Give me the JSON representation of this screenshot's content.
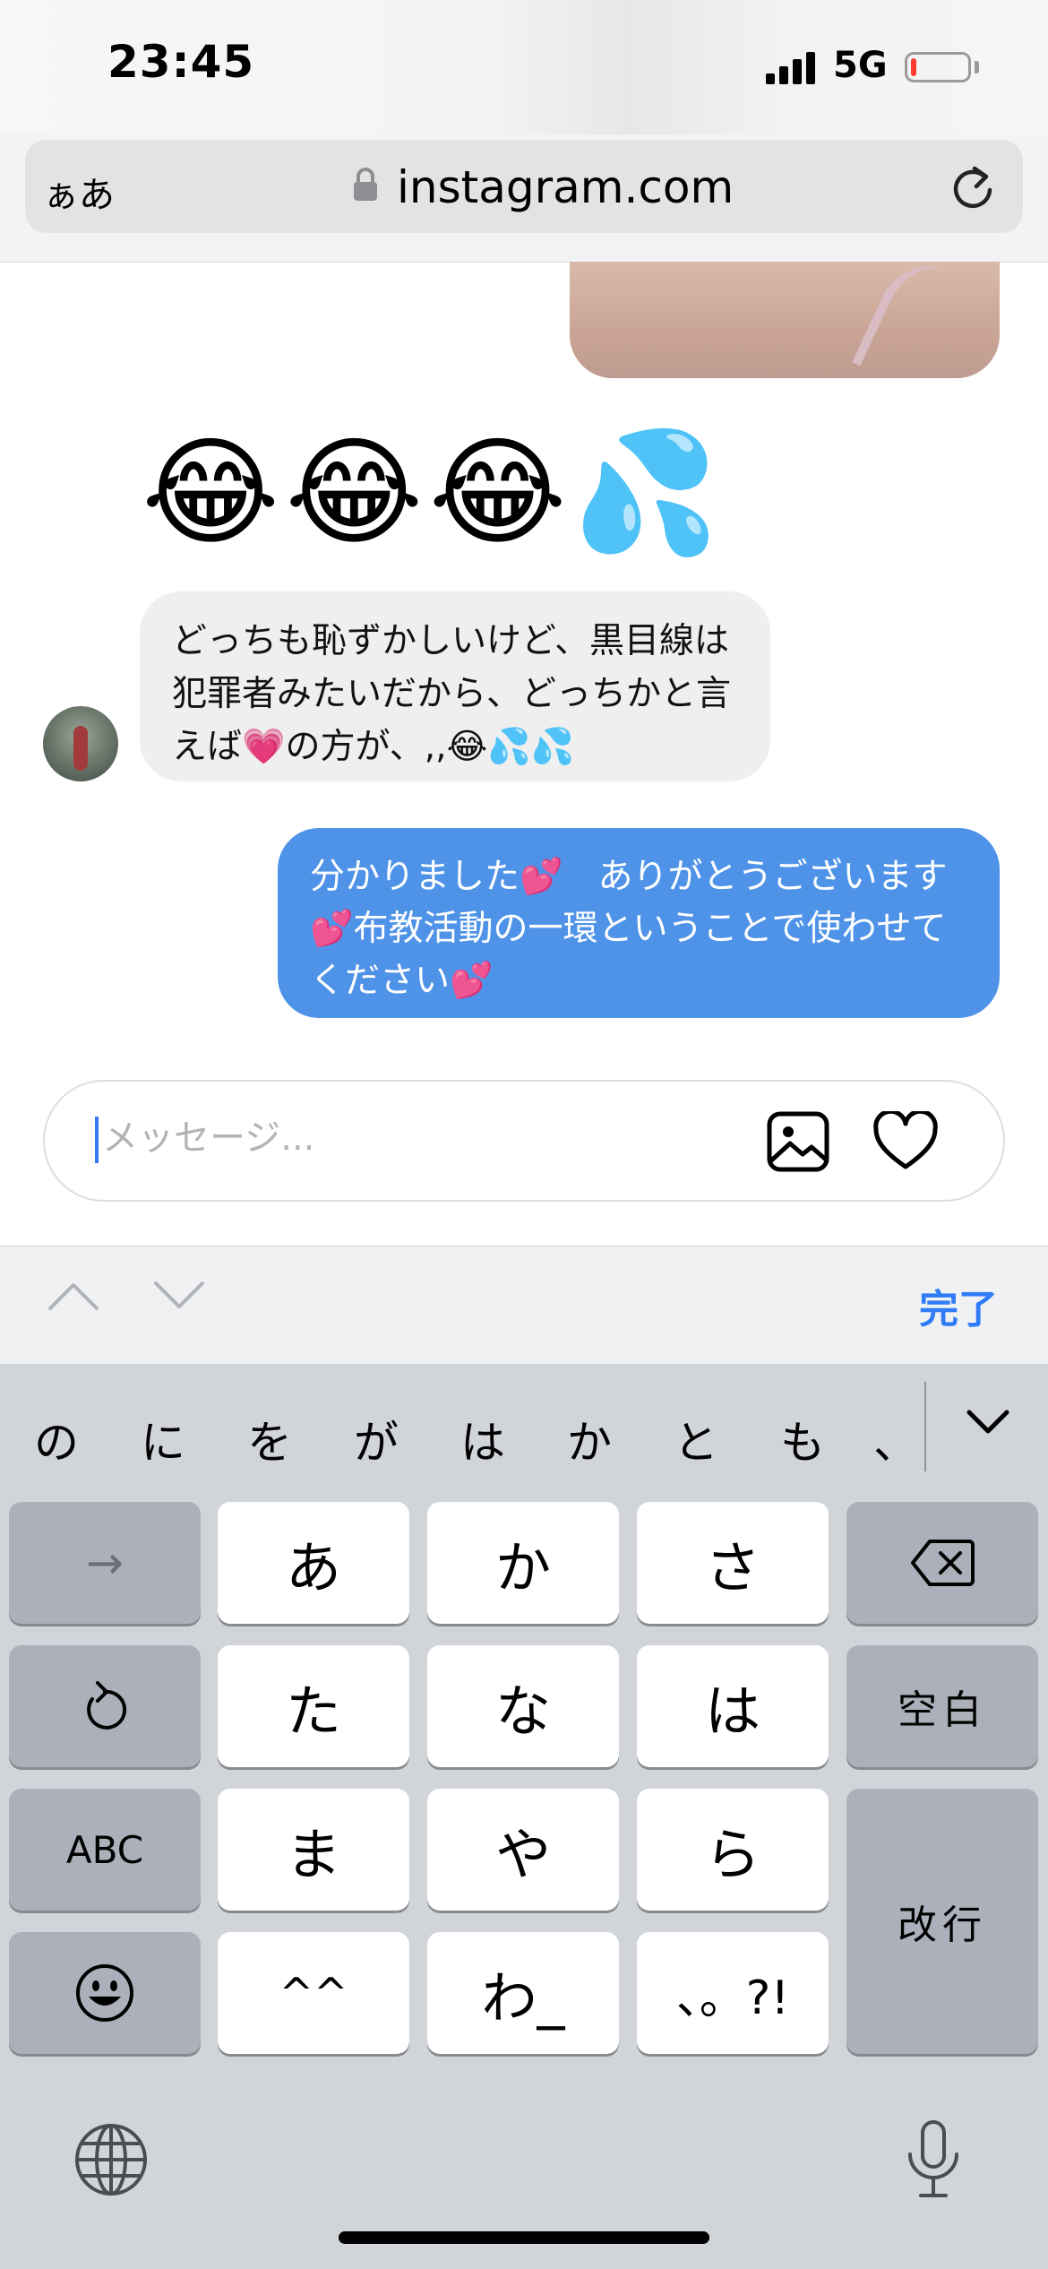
{
  "status_bar": {
    "time": "23:45",
    "network": "5G",
    "battery_level": 0.08
  },
  "browser": {
    "text_size_button": "ぁあ",
    "url": "instagram.com",
    "icons": [
      "lock-icon",
      "reload-icon"
    ]
  },
  "chat": {
    "emoji_message": "😂😂😂💦",
    "incoming_message": "どっちも恥ずかしいけど、黒目線は犯罪者みたいだから、どっちかと言えば💗の方が、,,😂💦💦",
    "outgoing_message": "分かりました💕　ありがとうございます💕布教活動の一環ということで使わせてください💕"
  },
  "composer": {
    "placeholder": "メッセージ...",
    "icons": [
      "gallery-icon",
      "heart-icon"
    ]
  },
  "keyboard_toolbar": {
    "done_label": "完了",
    "icons": [
      "chevron-up-icon",
      "chevron-down-icon"
    ]
  },
  "keyboard": {
    "candidates": [
      "の",
      "に",
      "を",
      "が",
      "は",
      "か",
      "と",
      "も",
      "、"
    ],
    "rows": [
      [
        "→",
        "あ",
        "か",
        "さ",
        "⌫"
      ],
      [
        "↺",
        "た",
        "な",
        "は",
        "空白"
      ],
      [
        "ABC",
        "ま",
        "や",
        "ら",
        "改行"
      ],
      [
        "☺",
        "^^",
        "わ_",
        "、。?!"
      ]
    ],
    "labels": {
      "next": "→",
      "a": "あ",
      "ka": "か",
      "sa": "さ",
      "ta": "た",
      "na": "な",
      "ha": "は",
      "space": "空白",
      "abc": "ABC",
      "ma": "ま",
      "ya": "や",
      "ra": "ら",
      "return": "改行",
      "kaomoji": "^^",
      "wa": "わ_",
      "punct": "、。?!"
    },
    "icons": [
      "backspace-icon",
      "undo-icon",
      "emoji-icon",
      "globe-icon",
      "microphone-icon"
    ]
  }
}
